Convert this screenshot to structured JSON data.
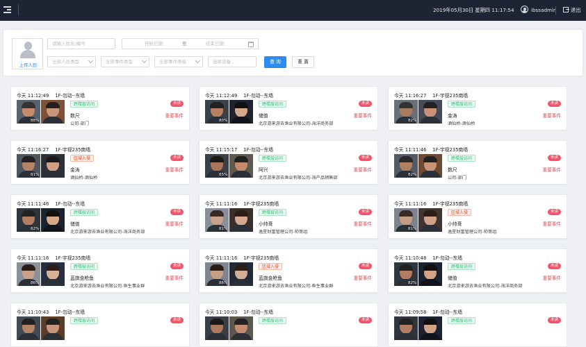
{
  "topbar": {
    "datetime": "2019年05月30日 星期四 11:17:54",
    "username": "ibssadmin",
    "logout": "退出"
  },
  "filters": {
    "upload_label": "上传人脸",
    "name_placeholder": "请输入姓名/编号",
    "start_date": "开始日期",
    "date_separator": "至",
    "end_date": "结束日期",
    "person_type": "全部人员类型",
    "event_type": "全部事件类型",
    "event_level": "全部事件等级",
    "device": "选择设备...",
    "query_button": "查 询",
    "reset_button": "重 置"
  },
  "colors": {
    "topbar": "#1d2433",
    "primary": "#2d8cf0",
    "tag_green": "#19be6b",
    "tag_red": "#ed4014",
    "badge_red": "#f0566b"
  },
  "events": [
    {
      "time": "今天 11:12:49",
      "location": "1F-勿动--东墙",
      "tag": "跨楼层访问",
      "tag_color": "green",
      "name": "数尺",
      "org": "公司-部门",
      "status": "未读",
      "level": "重要事件",
      "score": "88%",
      "a": [
        "#c58a6a",
        "#333",
        "#5a6270"
      ],
      "b": [
        "#c8967a",
        "#222",
        "#7d5138"
      ]
    },
    {
      "time": "今天 11:12:49",
      "location": "1F-勿动--东墙",
      "tag": "跨楼层访问",
      "tag_color": "green",
      "name": "储值",
      "org": "北京游来游去渔业有限公司-海洋商务部",
      "status": "未读",
      "level": "重要事件",
      "score": "80%",
      "a": [
        "#b98064",
        "#222",
        "#3c4048"
      ],
      "b": [
        "#d7a789",
        "#111",
        "#1f2430"
      ]
    },
    {
      "time": "今天 11:16:27",
      "location": "1F-宇视235南墙",
      "tag": "跨楼层访问",
      "tag_color": "green",
      "name": "金涛",
      "org": "酒仙桥-酒仙桥",
      "status": "未读",
      "level": "重要事件",
      "score": "82%",
      "a": [
        "#a87a5e",
        "#333",
        "#6b6f78"
      ],
      "b": [
        "#c99175",
        "#222",
        "#454b57"
      ]
    },
    {
      "time": "今天 11:16:27",
      "location": "1F-宇视235南墙",
      "tag": "区域入侵",
      "tag_color": "red",
      "name": "金涛",
      "org": "酒仙桥-酒仙桥",
      "status": "未读",
      "level": "重要事件",
      "score": "81%",
      "a": [
        "#b58466",
        "#222",
        "#50565f"
      ],
      "b": [
        "#d2a084",
        "#1a1a1a",
        "#2c3038"
      ]
    },
    {
      "time": "今天 11:15:17",
      "location": "1F-勿动--东墙",
      "tag": "跨楼层访问",
      "tag_color": "green",
      "name": "阿兴",
      "org": "北京游来游去渔业有限公司-海产品销售部",
      "status": "未读",
      "level": "重要事件",
      "score": "85%",
      "a": [
        "#a77558",
        "#1a1a1a",
        "#3b3f47"
      ],
      "b": [
        "#c38a6c",
        "#222",
        "#5f5a50"
      ]
    },
    {
      "time": "今天 11:11:46",
      "location": "1F-宇视235南墙",
      "tag": "跨楼层访问",
      "tag_color": "green",
      "name": "数尺",
      "org": "公司-部门",
      "status": "未读",
      "level": "重要事件",
      "score": "82%",
      "a": [
        "#b0805f",
        "#2a2a2a",
        "#555b66"
      ],
      "b": [
        "#c99478",
        "#222",
        "#6e4a33"
      ]
    },
    {
      "time": "今天 11:11:46",
      "location": "1F-勿动--东墙",
      "tag": "跨楼层访问",
      "tag_color": "green",
      "name": "储值",
      "org": "北京游来游去渔业有限公司-海洋商务部",
      "status": "未读",
      "level": "重要事件",
      "score": "82%",
      "a": [
        "#b27d60",
        "#222",
        "#2f343d"
      ],
      "b": [
        "#d6a688",
        "#111",
        "#1d2230"
      ]
    },
    {
      "time": "今天 11:11:16",
      "location": "1F-宇视235南墙",
      "tag": "跨楼层访问",
      "tag_color": "green",
      "name": "小帅哥",
      "org": "逸星财富管理公司-帅哥组",
      "status": "未读",
      "level": "重要事件",
      "score": "81%",
      "a": [
        "#c9a089",
        "#3a2a22",
        "#8a8f99"
      ],
      "b": [
        "#d4a98e",
        "#2b1e18",
        "#3a2f2a"
      ]
    },
    {
      "time": "今天 11:11:16",
      "location": "1F-宇视235南墙",
      "tag": "区域入侵",
      "tag_color": "red",
      "name": "小帅哥",
      "org": "逸星财富管理公司-帅哥组",
      "status": "未读",
      "level": "重要事件",
      "score": "81%",
      "a": [
        "#c59b83",
        "#3a2a22",
        "#7d828c"
      ],
      "b": [
        "#d0a388",
        "#2b1e18",
        "#403530"
      ]
    },
    {
      "time": "今天 11:11:16",
      "location": "1F-宇视235南墙",
      "tag": "跨楼层访问",
      "tag_color": "green",
      "name": "蓝旗金枪鱼",
      "org": "北京游来游去渔业有限公司-鱼生事业群",
      "status": "未读",
      "level": "重要事件",
      "score": "86%",
      "a": [
        "#caa08a",
        "#2b1e18",
        "#8c9099"
      ],
      "b": [
        "#d8b19a",
        "#2b1e18",
        "#273040"
      ]
    },
    {
      "time": "今天 11:11:16",
      "location": "1F-宇视235南墙",
      "tag": "区域入侵",
      "tag_color": "red",
      "name": "蓝旗金枪鱼",
      "org": "北京游来游去渔业有限公司-鱼生事业群",
      "status": "未读",
      "level": "重要事件",
      "score": "86%",
      "a": [
        "#c79e86",
        "#2b1e18",
        "#80858f"
      ],
      "b": [
        "#d5ad95",
        "#2b1e18",
        "#222a38"
      ]
    },
    {
      "time": "今天 11:10:48",
      "location": "1F-勿动--东墙",
      "tag": "跨楼层访问",
      "tag_color": "green",
      "name": "储值",
      "org": "北京游来游去渔业有限公司-海洋商务部",
      "status": "未读",
      "level": "重要事件",
      "score": "82%",
      "a": [
        "#b17c5f",
        "#222",
        "#30353e"
      ],
      "b": [
        "#d4a486",
        "#111",
        "#1c2130"
      ]
    },
    {
      "time": "今天 11:10:43",
      "location": "1F-勿动--东墙",
      "tag": "跨楼层访问",
      "tag_color": "green",
      "name": "",
      "org": "",
      "status": "未读",
      "level": "",
      "score": "",
      "a": [
        "#b58365",
        "#222",
        "#444a55"
      ],
      "b": [
        "#c8967a",
        "#222",
        "#5b3d2a"
      ]
    },
    {
      "time": "今天 11:10:03",
      "location": "1F-勿动--东墙",
      "tag": "跨楼层访问",
      "tag_color": "green",
      "name": "",
      "org": "",
      "status": "未读",
      "level": "",
      "score": "",
      "a": [
        "#a97a5c",
        "#1a1a1a",
        "#3a3e46"
      ],
      "b": [
        "#c48c6e",
        "#222",
        "#5d584e"
      ]
    },
    {
      "time": "今天 11:09:58",
      "location": "1F-勿动--东墙",
      "tag": "跨楼层访问",
      "tag_color": "green",
      "name": "",
      "org": "",
      "status": "未读",
      "level": "",
      "score": "",
      "a": [
        "#b07e60",
        "#222",
        "#2f343d"
      ],
      "b": [
        "#d3a385",
        "#111",
        "#1d2230"
      ]
    }
  ]
}
